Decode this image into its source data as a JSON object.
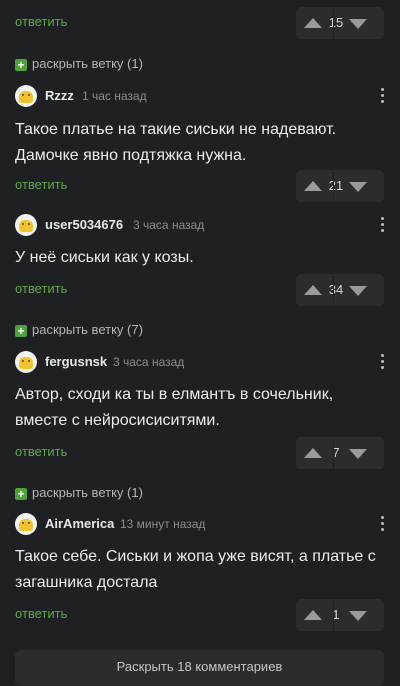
{
  "reply_label": "ответить",
  "expand_all_label": "Раскрыть 18 комментариев",
  "top_row": {
    "votes": "15"
  },
  "branches": [
    {
      "label": "раскрыть ветку (1)"
    },
    {
      "label": "раскрыть ветку (7)"
    },
    {
      "label": "раскрыть ветку (1)"
    }
  ],
  "comments": [
    {
      "username": "Rzzz",
      "time": "1 час назад",
      "text": "Такое платье на такие сиськи не надевают. Дамочке явно подтяжка нужна.",
      "votes": "21"
    },
    {
      "username": "user5034676",
      "time": "3 часа назад",
      "text": "У неё сиськи как у козы.",
      "votes": "34"
    },
    {
      "username": "fergusnsk",
      "time": "3 часа назад",
      "text": "Автор, сходи ка ты в елмантъ в сочельник, вместе с нейросисиситями.",
      "votes": "7"
    },
    {
      "username": "AirAmerica",
      "time": "13 минут назад",
      "text": "Такое себе. Сиськи и жопа уже висят, а платье с загашника достала",
      "votes": "1"
    }
  ],
  "colors": {
    "background": "#1f2023",
    "accent_green": "#5fa548",
    "vote_box": "#2b2c30"
  },
  "icons": [
    "plus-icon",
    "upvote-icon",
    "downvote-icon",
    "more-vertical-icon",
    "avatar-icon"
  ]
}
